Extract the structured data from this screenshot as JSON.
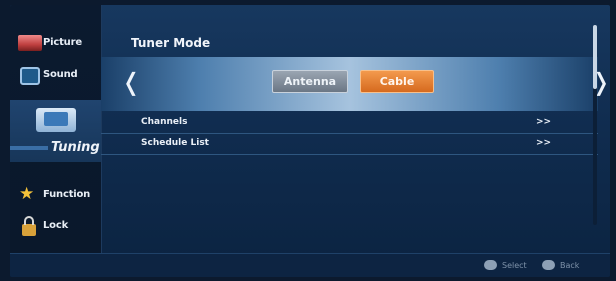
{
  "sidebar": {
    "items": [
      {
        "label": "Picture",
        "icon": "picture-icon"
      },
      {
        "label": "Sound",
        "icon": "sound-icon"
      },
      {
        "label": "Tuning",
        "icon": "tuning-icon",
        "selected": true
      },
      {
        "label": "Function",
        "icon": "star-icon"
      },
      {
        "label": "Lock",
        "icon": "lock-icon"
      }
    ]
  },
  "main": {
    "title": "Tuner Mode",
    "modes": [
      {
        "label": "Antenna",
        "selected": false
      },
      {
        "label": "Cable",
        "selected": true
      }
    ],
    "list": [
      {
        "label": "Channels",
        "arrow": ">>"
      },
      {
        "label": "Schedule List",
        "arrow": ">>"
      }
    ]
  },
  "footer": {
    "select_label": "Select",
    "back_label": "Back"
  },
  "colors": {
    "accent": "#e8842f",
    "background": "#102c4f"
  }
}
